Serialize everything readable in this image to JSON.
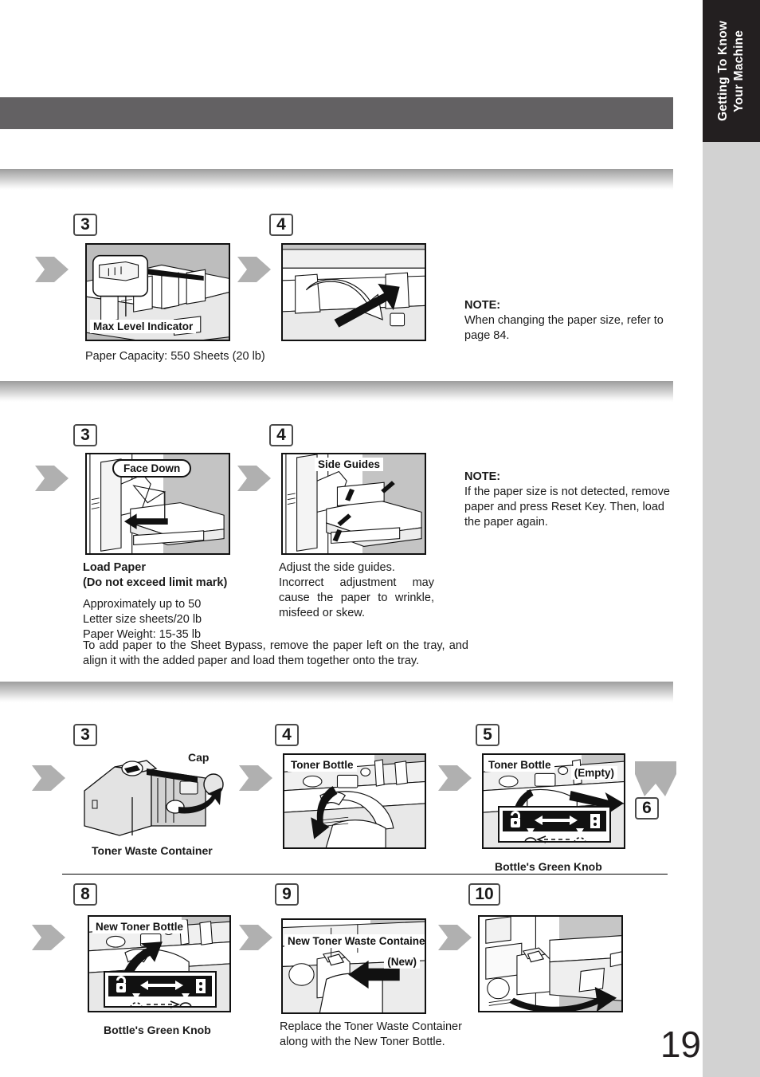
{
  "page": {
    "number": "19",
    "side_tab": "Getting To Know\nYour Machine",
    "colors": {
      "side_tab_dark": "#231f20",
      "side_tab_gray": "#d2d2d2",
      "header_bar": "#636163",
      "chevron": "#b0b0b0",
      "photo_shade": "#c9c9c9"
    }
  },
  "sections": [
    {
      "id": "paper-tray",
      "steps": [
        {
          "number": "3",
          "callouts": [
            "Max Level Indicator"
          ],
          "caption": "Paper Capacity: 550 Sheets (20 lb)"
        },
        {
          "number": "4",
          "callouts": [],
          "caption": ""
        }
      ],
      "note": {
        "heading": "NOTE:",
        "body": "When changing the paper size, refer to page 84."
      }
    },
    {
      "id": "sheet-bypass",
      "steps": [
        {
          "number": "3",
          "callouts": [
            "Face Down"
          ],
          "caption_bold_1": "Load Paper",
          "caption_bold_2": "(Do not exceed limit mark)",
          "caption_body": "Approximately up to 50\nLetter size sheets/20 lb\nPaper Weight: 15-35 lb"
        },
        {
          "number": "4",
          "callouts": [
            "Side Guides"
          ],
          "caption_line_1": "Adjust the side guides.",
          "caption_body": "Incorrect adjustment may cause the paper to wrinkle, misfeed or skew."
        }
      ],
      "footer": "To add paper to the Sheet Bypass, remove the paper left on the tray, and align it with the added paper and load them together onto the tray.",
      "note": {
        "heading": "NOTE:",
        "body": "If the paper size is not detected, remove paper and press Reset Key. Then, load the paper again."
      }
    },
    {
      "id": "toner-replacement-top",
      "steps": [
        {
          "number": "3",
          "callouts": [
            "Cap"
          ],
          "caption": "Toner Waste Container"
        },
        {
          "number": "4",
          "callouts": [
            "Toner Bottle"
          ],
          "caption": ""
        },
        {
          "number": "5",
          "callouts": [
            "Toner Bottle",
            "(Empty)"
          ],
          "caption": "Bottle's Green Knob"
        },
        {
          "number": "6",
          "callouts": [],
          "caption": ""
        }
      ]
    },
    {
      "id": "toner-replacement-bottom",
      "steps": [
        {
          "number": "8",
          "callouts": [
            "New Toner Bottle"
          ],
          "caption": "Bottle's Green Knob"
        },
        {
          "number": "9",
          "callouts": [
            "New Toner Waste Container",
            "(New)"
          ],
          "caption": "Replace the Toner Waste Container along with the New Toner Bottle."
        },
        {
          "number": "10",
          "callouts": [],
          "caption": ""
        }
      ]
    }
  ]
}
